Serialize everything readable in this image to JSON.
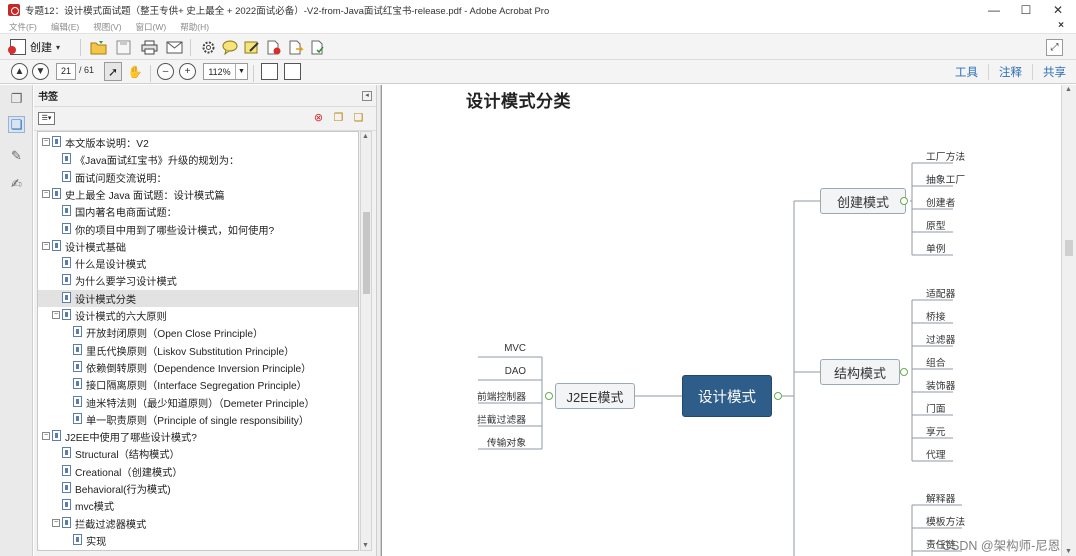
{
  "window": {
    "title": "专题12：设计模式面试题（整王专供+ 史上最全 + 2022面试必备）-V2-from-Java面试红宝书-release.pdf - Adobe Acrobat Pro",
    "min": "—",
    "max": "☐",
    "close": "✕"
  },
  "menu": {
    "items": [
      "文件(F)",
      "编辑(E)",
      "视图(V)",
      "窗口(W)",
      "帮助(H)"
    ],
    "doc_close": "×"
  },
  "toolbar1": {
    "create_label": "创建"
  },
  "toolbar2": {
    "page_current": "21",
    "page_total": "/ 61",
    "zoom": "112%",
    "tools": "工具",
    "comment": "注释",
    "share": "共享"
  },
  "bookmarks": {
    "header": "书签",
    "items": [
      {
        "label": "本文版本说明：V2",
        "level": 0,
        "toggle": "⊟"
      },
      {
        "label": "《Java面试红宝书》升级的规划为：",
        "level": 1
      },
      {
        "label": "面试问题交流说明：",
        "level": 1
      },
      {
        "label": "史上最全 Java 面试题：设计模式篇",
        "level": 0,
        "toggle": "⊟"
      },
      {
        "label": "国内著名电商面试题：",
        "level": 1
      },
      {
        "label": "你的项目中用到了哪些设计模式，如何使用?",
        "level": 1
      },
      {
        "label": "设计模式基础",
        "level": 0,
        "toggle": "⊟"
      },
      {
        "label": "什么是设计模式",
        "level": 1
      },
      {
        "label": "为什么要学习设计模式",
        "level": 1
      },
      {
        "label": "设计模式分类",
        "level": 1,
        "selected": true
      },
      {
        "label": "设计模式的六大原则",
        "level": 1,
        "toggle": "⊟"
      },
      {
        "label": "开放封闭原则（Open Close Principle）",
        "level": 2
      },
      {
        "label": "里氏代换原则（Liskov Substitution Principle）",
        "level": 2
      },
      {
        "label": "依赖倒转原则（Dependence Inversion Principle）",
        "level": 2
      },
      {
        "label": "接口隔离原则（Interface Segregation Principle）",
        "level": 2
      },
      {
        "label": "迪米特法则（最少知道原则）（Demeter Principle）",
        "level": 2
      },
      {
        "label": "单一职责原则（Principle of single responsibility）",
        "level": 2
      },
      {
        "label": "J2EE中使用了哪些设计模式?",
        "level": 0,
        "toggle": "⊟"
      },
      {
        "label": "Structural（结构模式）",
        "level": 1
      },
      {
        "label": "Creational（创建模式）",
        "level": 1
      },
      {
        "label": "Behavioral(行为模式)",
        "level": 1
      },
      {
        "label": "mvc模式",
        "level": 1
      },
      {
        "label": "拦截过滤器模式",
        "level": 1,
        "toggle": "⊟"
      },
      {
        "label": "实现",
        "level": 2
      }
    ]
  },
  "document": {
    "heading": "设计模式分类",
    "mindmap": {
      "center": "设计模式",
      "branches": {
        "creational": {
          "label": "创建模式",
          "leaves": [
            "工厂方法",
            "抽象工厂",
            "创建者",
            "原型",
            "单例"
          ]
        },
        "structural": {
          "label": "结构模式",
          "leaves": [
            "适配器",
            "桥接",
            "过滤器",
            "组合",
            "装饰器",
            "门面",
            "享元",
            "代理"
          ]
        },
        "behavioral": {
          "leaves": [
            "解释器",
            "模板方法",
            "责任链"
          ]
        },
        "j2ee": {
          "label": "J2EE模式",
          "leaves": [
            "MVC",
            "DAO",
            "前端控制器",
            "拦截过滤器",
            "传输对象"
          ]
        }
      }
    }
  },
  "watermark": "CSDN @架构师-尼恩"
}
